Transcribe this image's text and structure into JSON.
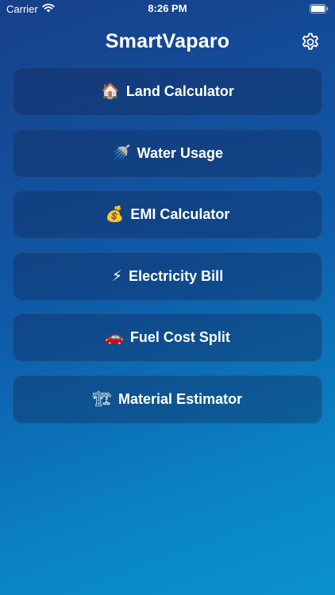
{
  "status_bar": {
    "carrier": "Carrier",
    "time": "8:26 PM",
    "wifi_icon": "wifi-icon",
    "battery_icon": "battery-icon"
  },
  "header": {
    "title": "SmartVaparo",
    "settings_icon": "gear-icon"
  },
  "menu": {
    "items": [
      {
        "icon": "🏠",
        "icon_name": "house-icon",
        "label": "Land Calculator"
      },
      {
        "icon": "🚿",
        "icon_name": "shower-icon",
        "label": "Water Usage"
      },
      {
        "icon": "💰",
        "icon_name": "money-bag-icon",
        "label": "EMI Calculator"
      },
      {
        "icon": "⚡",
        "icon_name": "lightning-icon",
        "label": "Electricity Bill"
      },
      {
        "icon": "🚗",
        "icon_name": "car-icon",
        "label": "Fuel Cost Split"
      },
      {
        "icon": "🏗",
        "icon_name": "crane-icon",
        "label": "Material Estimator"
      }
    ]
  },
  "colors": {
    "background_top": "#183f89",
    "background_bottom": "#0a92cc",
    "card_fill": "#122858",
    "text": "#ffffff"
  }
}
